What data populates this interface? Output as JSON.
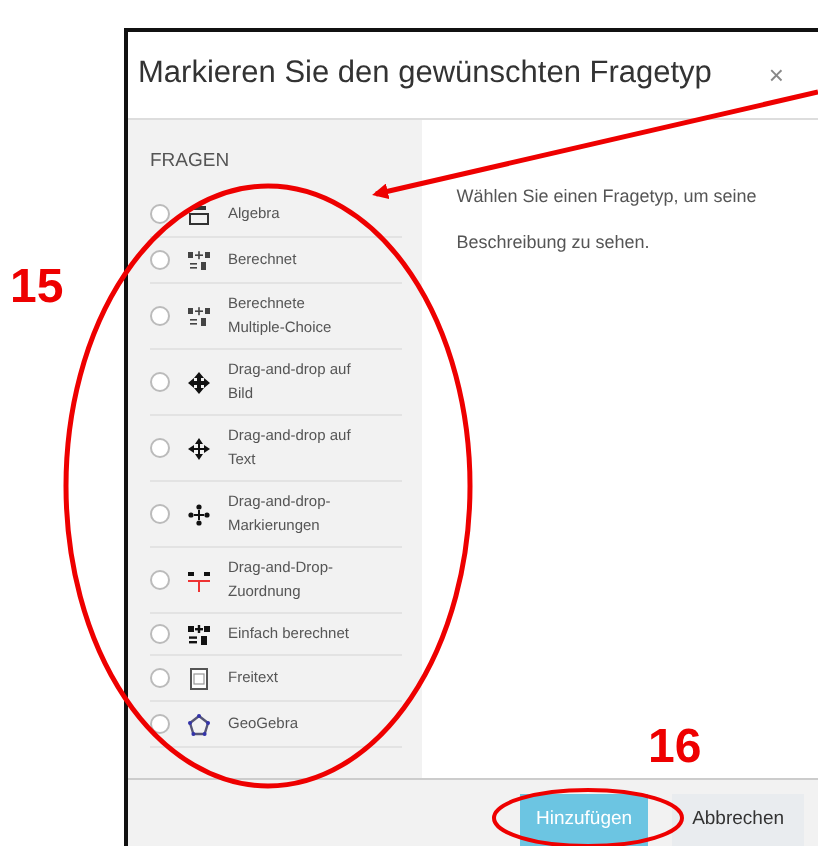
{
  "dialog": {
    "title": "Markieren Sie den gewünschten Fragetyp",
    "close": "×"
  },
  "sidebar": {
    "heading": "FRAGEN",
    "items": [
      {
        "label": "Algebra",
        "selected": false
      },
      {
        "label": "Berechnet",
        "selected": false
      },
      {
        "label": "Berechnete Multiple-Choice",
        "selected": false
      },
      {
        "label": "Drag-and-drop auf Bild",
        "selected": false
      },
      {
        "label": "Drag-and-drop auf Text",
        "selected": false
      },
      {
        "label": "Drag-and-drop-Markierungen",
        "selected": false
      },
      {
        "label": "Drag-and-Drop-Zuordnung",
        "selected": false
      },
      {
        "label": "Einfach berechnet",
        "selected": false
      },
      {
        "label": "Freitext",
        "selected": false
      },
      {
        "label": "GeoGebra",
        "selected": false
      }
    ]
  },
  "description": "Wählen Sie einen Fragetyp, um seine Beschreibung zu sehen.",
  "buttons": [
    {
      "label": "Hinzufügen",
      "kind": "primary",
      "disabled": true
    },
    {
      "label": "Abbrechen",
      "kind": "secondary",
      "disabled": false
    }
  ],
  "annotations": [
    {
      "text": "15"
    },
    {
      "text": "16"
    }
  ]
}
